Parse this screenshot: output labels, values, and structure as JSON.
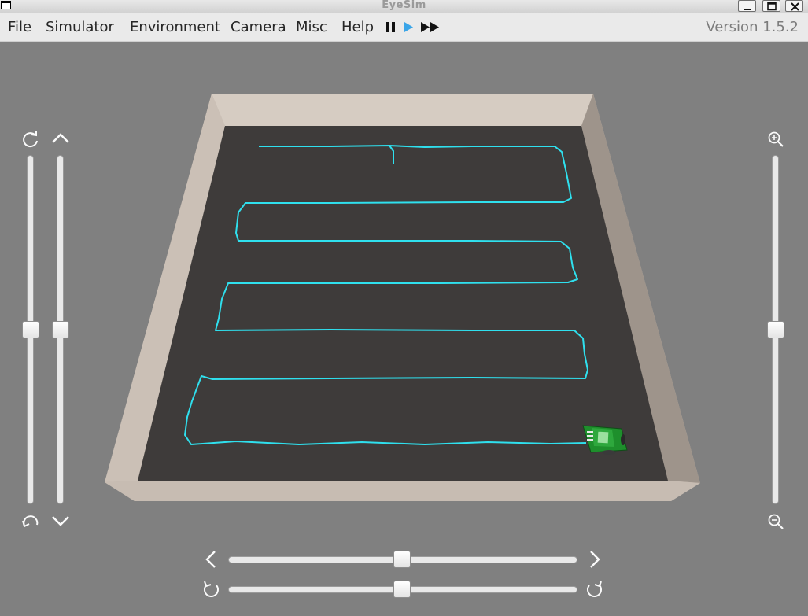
{
  "window": {
    "title": "EyeSim"
  },
  "menu": {
    "file": "File",
    "simulator": "Simulator",
    "environment": "Environment",
    "camera": "Camera",
    "misc": "Misc",
    "help": "Help"
  },
  "version": "Version 1.5.2",
  "colors": {
    "background": "#808080",
    "floor": "#3f3c3b",
    "wall": "#bfb4aa",
    "trail": "#2fe0ee",
    "robot": "#22a033",
    "play_accent": "#3aa5e8"
  },
  "icons": {
    "pause": "pause-icon",
    "play": "play-icon",
    "fast_forward": "fast-forward-icon",
    "rotate_up": "rotate-icon",
    "rotate_down": "rotate-icon",
    "tilt_up": "chevron-up-icon",
    "tilt_down": "chevron-down-icon",
    "zoom_in": "zoom-in-icon",
    "zoom_out": "zoom-out-icon",
    "pan_left": "chevron-left-icon",
    "pan_right": "chevron-right-icon",
    "rotate_left": "rotate-ccw-icon",
    "rotate_right": "rotate-cw-icon"
  },
  "sliders": {
    "camera_rotate_vertical": 0.5,
    "camera_tilt_vertical": 0.5,
    "camera_zoom": 0.5,
    "camera_pan_horizontal": 0.5,
    "camera_rotate_horizontal": 0.5
  }
}
